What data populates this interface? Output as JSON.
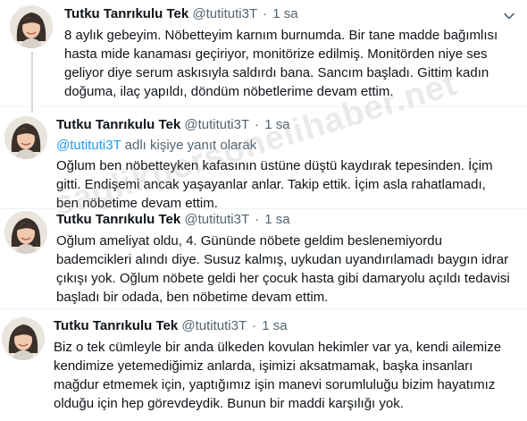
{
  "watermark": "saglikpersonelihaber.net",
  "tweets": [
    {
      "name": "Tutku Tanrıkulu Tek",
      "handle": "@tutituti3T",
      "time": "1 sa",
      "reply_prefix": "",
      "reply_suffix": "",
      "text": "8 aylık gebeyim. Nöbetteyim karnım burnumda. Bir tane madde bağımlısı\nhasta mide kanaması geçiriyor, monitörize edilmiş. Monitörden niye ses\ngeliyor diye serum askısıyla saldırdı bana. Sancım başladı. Gittim kadın\ndoğuma, ilaç yapıldı, döndüm nöbetlerime devam ettim."
    },
    {
      "name": "Tutku Tanrıkulu Tek",
      "handle": "@tutituti3T",
      "time": "1 sa",
      "reply_prefix": "@tutituti3T",
      "reply_suffix": " adlı kişiye yanıt olarak",
      "text": "Oğlum ben nöbetteyken kafasının üstüne düştü kaydırak tepesinden. İçim\ngitti. Endişemi ancak yaşayanlar anlar. Takip ettik. İçim asla rahatlamadı,\nben nöbetime devam ettim."
    },
    {
      "name": "Tutku Tanrıkulu Tek",
      "handle": "@tutituti3T",
      "time": "1 sa",
      "reply_prefix": "",
      "reply_suffix": "",
      "text": "Oğlum ameliyat oldu, 4. Gününde nöbete geldim beslenemiyordu\nbademcikleri alındı diye. Susuz kalmış, uykudan uyandırılamadı baygın idrar\nçıkışı yok. Oğlum nöbete geldi her çocuk hasta gibi damaryolu açıldı tedavisi\nbaşladı bir odada, ben nöbetime devam ettim."
    },
    {
      "name": "Tutku Tanrıkulu Tek",
      "handle": "@tutituti3T",
      "time": "1 sa",
      "reply_prefix": "",
      "reply_suffix": "",
      "text": "Biz o tek cümleyle bir anda ülkeden kovulan hekimler var ya, kendi ailemize\nkendimize yetemediğimiz anlarda, işimizi aksatmamak, başka insanları\nmağdur etmemek için, yaptığımız işin manevi sorumluluğu bizim hayatımız\nolduğu için hep görevdeydik. Bunun bir maddi karşılığı yok."
    }
  ]
}
